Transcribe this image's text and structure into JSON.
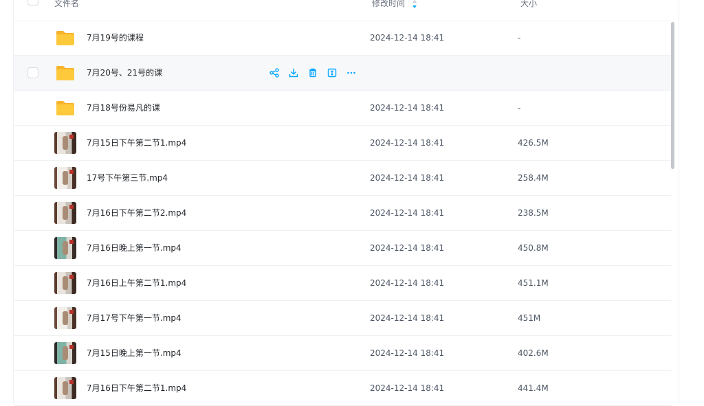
{
  "header": {
    "name_label": "文件名",
    "modified_label": "修改时间",
    "size_label": "大小"
  },
  "colors": {
    "accent": "#06a7ff",
    "folder": "#ffc93c",
    "folder_back": "#f7b32b"
  },
  "files": [
    {
      "name": "7月19号的课程",
      "type": "folder",
      "modified": "2024-12-14 18:41",
      "size": "-"
    },
    {
      "name": "7月20号、21号的课",
      "type": "folder",
      "modified": "",
      "size": "",
      "hovered": true
    },
    {
      "name": "7月18号份易凡的课",
      "type": "folder",
      "modified": "2024-12-14 18:41",
      "size": "-"
    },
    {
      "name": "7月15日下午第二节1.mp4",
      "type": "video",
      "modified": "2024-12-14 18:41",
      "size": "426.5M"
    },
    {
      "name": "17号下午第三节.mp4",
      "type": "video",
      "modified": "2024-12-14 18:41",
      "size": "258.4M"
    },
    {
      "name": "7月16日下午第二节2.mp4",
      "type": "video",
      "modified": "2024-12-14 18:41",
      "size": "238.5M"
    },
    {
      "name": "7月16日晚上第一节.mp4",
      "type": "video",
      "modified": "2024-12-14 18:41",
      "size": "450.8M"
    },
    {
      "name": "7月16日上午第二节1.mp4",
      "type": "video",
      "modified": "2024-12-14 18:41",
      "size": "451.1M"
    },
    {
      "name": "7月17号下午第一节.mp4",
      "type": "video",
      "modified": "2024-12-14 18:41",
      "size": "451M"
    },
    {
      "name": "7月15日晚上第一节.mp4",
      "type": "video",
      "modified": "2024-12-14 18:41",
      "size": "402.6M"
    },
    {
      "name": "7月16日下午第二节1.mp4",
      "type": "video",
      "modified": "2024-12-14 18:41",
      "size": "441.4M"
    }
  ],
  "row_actions": [
    "share-icon",
    "download-icon",
    "delete-icon",
    "rename-icon",
    "more-icon"
  ]
}
